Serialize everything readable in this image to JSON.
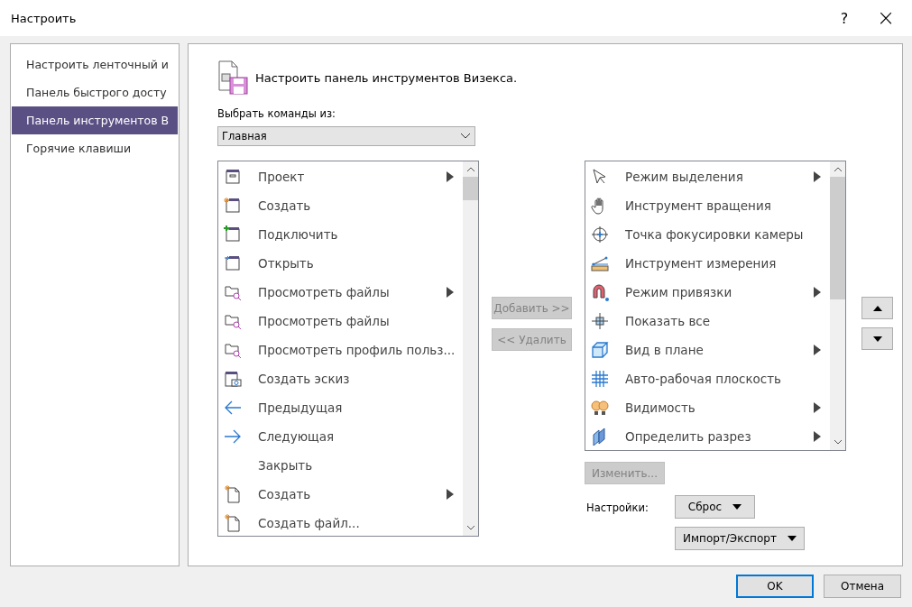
{
  "window": {
    "title": "Настроить",
    "help_button": "?",
    "close_button": "×"
  },
  "nav": {
    "items": [
      {
        "label": "Настроить ленточный и",
        "selected": false
      },
      {
        "label": "Панель быстрого досту",
        "selected": false
      },
      {
        "label": "Панель инструментов В",
        "selected": true
      },
      {
        "label": "Горячие клавиши",
        "selected": false
      }
    ]
  },
  "panel": {
    "heading": "Настроить панель инструментов Визекса.",
    "source_label": "Выбрать команды из:",
    "source_select": "Главная",
    "commands": [
      {
        "label": "Проект",
        "submenu": true
      },
      {
        "label": "Создать",
        "submenu": false
      },
      {
        "label": "Подключить",
        "submenu": false
      },
      {
        "label": "Открыть",
        "submenu": false
      },
      {
        "label": "Просмотреть файлы",
        "submenu": true
      },
      {
        "label": "Просмотреть файлы",
        "submenu": false
      },
      {
        "label": "Просмотреть профиль польз...",
        "submenu": false
      },
      {
        "label": "Создать эскиз",
        "submenu": false
      },
      {
        "label": "Предыдущая",
        "submenu": false
      },
      {
        "label": "Следующая",
        "submenu": false
      },
      {
        "label": "Закрыть",
        "submenu": false
      },
      {
        "label": "Создать",
        "submenu": true
      },
      {
        "label": "Создать файл...",
        "submenu": false
      }
    ],
    "add_button": {
      "label": "Добавить >>",
      "disabled": true
    },
    "remove_button": {
      "label": "<< Удалить",
      "disabled": true
    },
    "toolbar_items": [
      {
        "label": "Режим выделения",
        "submenu": true
      },
      {
        "label": "Инструмент вращения",
        "submenu": false
      },
      {
        "label": "Точка фокусировки камеры",
        "submenu": false
      },
      {
        "label": "Инструмент измерения",
        "submenu": false
      },
      {
        "label": "Режим привязки",
        "submenu": true
      },
      {
        "label": "Показать все",
        "submenu": false
      },
      {
        "label": "Вид в плане",
        "submenu": true
      },
      {
        "label": "Авто-рабочая плоскость",
        "submenu": false
      },
      {
        "label": "Видимость",
        "submenu": true
      },
      {
        "label": "Определить разрез",
        "submenu": true
      }
    ],
    "modify_button": {
      "label": "Изменить...",
      "disabled": true
    },
    "settings_label": "Настройки:",
    "reset_button": "Сброс",
    "import_export_button": "Импорт/Экспорт"
  },
  "footer": {
    "ok_button": "OK",
    "cancel_button": "Отмена"
  }
}
